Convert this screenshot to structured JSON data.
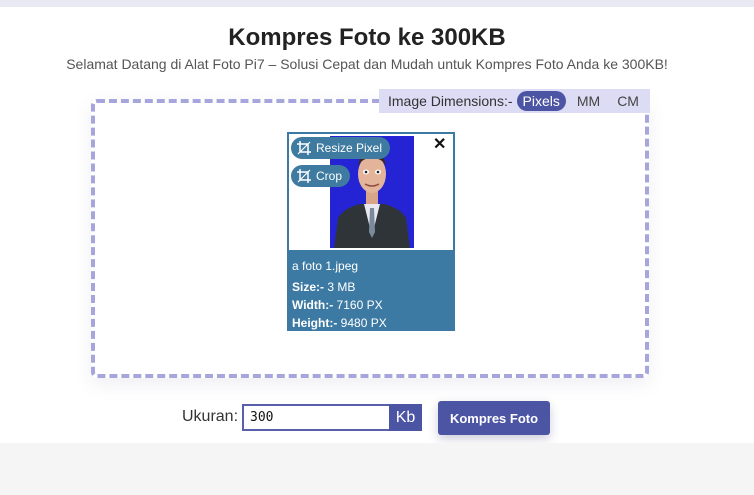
{
  "page": {
    "title": "Kompres Foto ke 300KB",
    "subtitle": "Selamat Datang di Alat Foto Pi7 – Solusi Cepat dan Mudah untuk Kompres Foto Anda ke 300KB!"
  },
  "dimensions": {
    "label": "Image Dimensions:-",
    "options": [
      "Pixels",
      "MM",
      "CM"
    ],
    "selected": "Pixels"
  },
  "file_card": {
    "resize_label": "Resize Pixel",
    "crop_label": "Crop",
    "close_icon": "close-icon",
    "filename": "a foto 1.jpeg",
    "size_label": "Size:-",
    "size_value": "3 MB",
    "width_label": "Width:-",
    "width_value": "7160 PX",
    "height_label": "Height:-",
    "height_value": "9480 PX"
  },
  "form": {
    "size_label": "Ukuran:",
    "size_value": "300",
    "unit": "Kb",
    "submit_label": "Kompres Foto"
  },
  "colors": {
    "accent": "#4c54a4",
    "card_blue": "#3d7aa3",
    "dashed_border": "#a6a6dc"
  }
}
